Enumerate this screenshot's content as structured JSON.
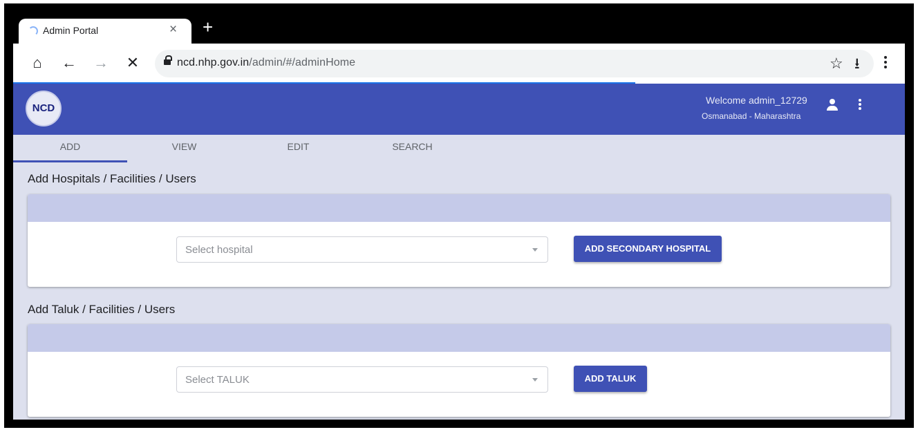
{
  "browser": {
    "tab_title": "Admin Portal",
    "tab_close": "×",
    "new_tab": "+",
    "url_host": "ncd.nhp.gov.in",
    "url_path": "/admin/#/adminHome",
    "home_icon": "⌂",
    "back_icon": "←",
    "forward_icon": "→",
    "stop_icon": "✕",
    "star_icon": "☆",
    "download_icon": "⭳"
  },
  "header": {
    "logo_text": "NCD",
    "welcome": "Welcome admin_12729",
    "location": "Osmanabad - Maharashtra",
    "accent_color": "#3f51b5"
  },
  "tabs": [
    {
      "label": "ADD"
    },
    {
      "label": "VIEW"
    },
    {
      "label": "EDIT"
    },
    {
      "label": "SEARCH"
    }
  ],
  "sections": {
    "hospital": {
      "title": "Add Hospitals / Facilities / Users",
      "select_placeholder": "Select hospital",
      "button_label": "ADD SECONDARY HOSPITAL"
    },
    "taluk": {
      "title": "Add Taluk / Facilities / Users",
      "select_placeholder": "Select TALUK",
      "button_label": "ADD TALUK"
    }
  }
}
